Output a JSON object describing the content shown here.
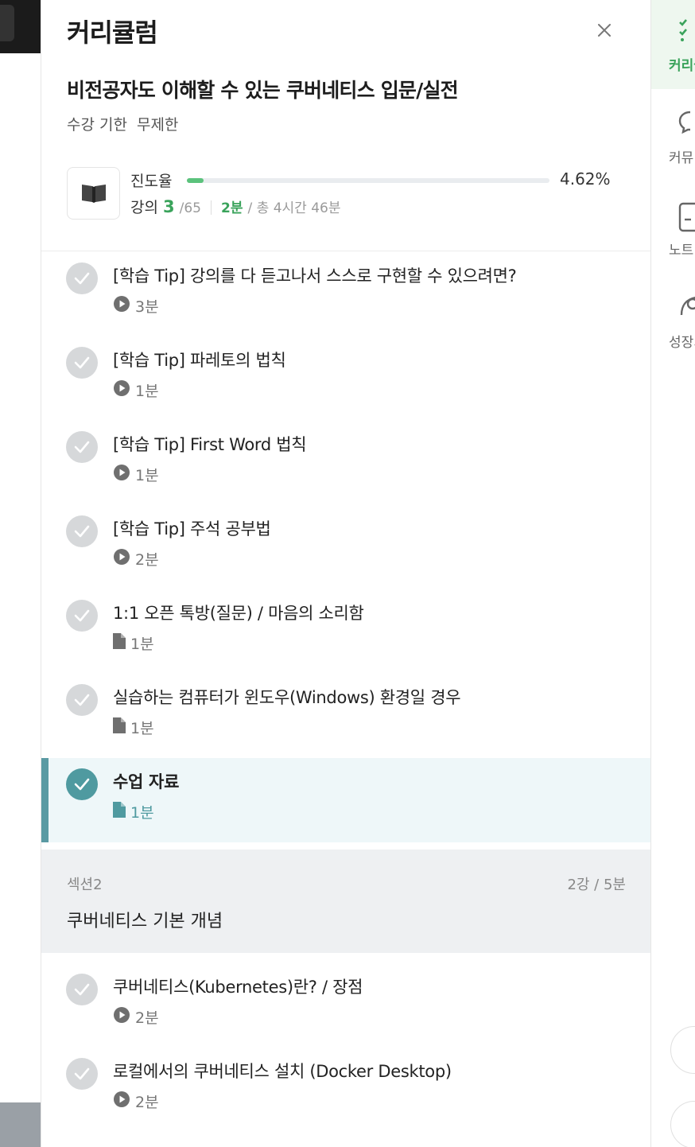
{
  "header": {
    "title": "커리큘럼",
    "course_title": "비전공자도 이해할 수 있는 쿠버네티스 입문/실전",
    "period_label": "수강 기한",
    "period_value": "무제한"
  },
  "progress": {
    "label": "진도율",
    "percent_text": "4.62%",
    "fraction": 0.0462,
    "lecture_label": "강의",
    "lectures_done": "3",
    "lectures_total": "/65",
    "time_done": "2분",
    "time_total": "/ 총 4시간 46분"
  },
  "lectures": [
    {
      "title": "[학습 Tip] 강의를 다 듣고나서 스스로 구현할 수 있으려면?",
      "type": "video-icon",
      "duration": "3분"
    },
    {
      "title": "[학습 Tip] 파레토의 법칙",
      "type": "video-icon",
      "duration": "1분"
    },
    {
      "title": "[학습 Tip] First Word 법칙",
      "type": "video-icon",
      "duration": "1분"
    },
    {
      "title": "[학습 Tip] 주석 공부법",
      "type": "video-icon",
      "duration": "2분"
    },
    {
      "title": "1:1 오픈 톡방(질문) / 마음의 소리함",
      "type": "document-icon",
      "duration": "1분"
    },
    {
      "title": "실습하는 컴퓨터가 윈도우(Windows) 환경일 경우",
      "type": "document-icon",
      "duration": "1분"
    },
    {
      "title": "수업 자료",
      "type": "document-icon",
      "duration": "1분",
      "active": true
    }
  ],
  "section2": {
    "label": "섹션2",
    "count": "2강 / 5분",
    "title": "쿠버네티스 기본 개념",
    "lectures": [
      {
        "title": "쿠버네티스(Kubernetes)란? / 장점",
        "type": "video-icon",
        "duration": "2분"
      },
      {
        "title": "로컬에서의 쿠버네티스 설치 (Docker Desktop)",
        "type": "video-icon",
        "duration": "2분"
      }
    ]
  },
  "rail": [
    {
      "label": "커리큘럼",
      "icon": "checklist-icon",
      "active": true
    },
    {
      "label": "커뮤니티",
      "icon": "chat-bubble-icon"
    },
    {
      "label": "노트",
      "icon": "note-icon"
    },
    {
      "label": "성장기록",
      "icon": "growth-icon"
    }
  ],
  "colors": {
    "accent_green": "#3aa35b",
    "active_teal": "#4f9aa0",
    "progress_fill": "#5bc27c"
  }
}
